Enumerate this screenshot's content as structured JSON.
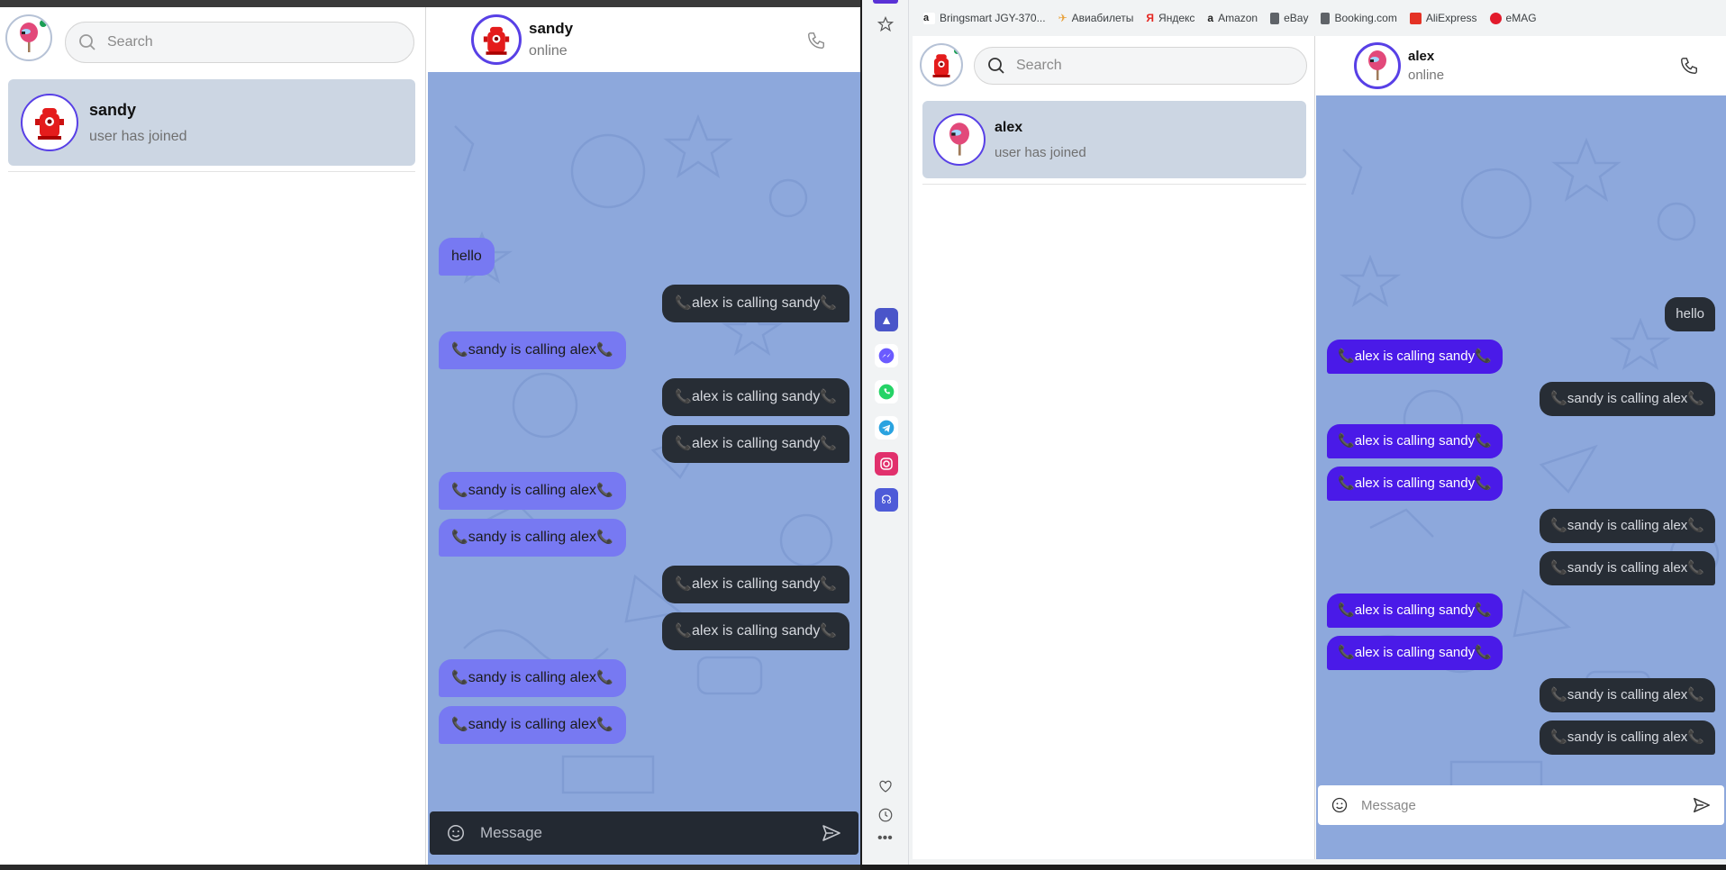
{
  "left_app": {
    "search_placeholder": "Search",
    "contact": {
      "name": "sandy",
      "subtitle": "user has joined"
    },
    "chat": {
      "name": "sandy",
      "status": "online",
      "composer_placeholder": "Message",
      "messages": [
        {
          "dir": "in",
          "text": "hello"
        },
        {
          "dir": "out",
          "text": "alex is calling sandy"
        },
        {
          "dir": "in",
          "text": "sandy is calling alex"
        },
        {
          "dir": "out",
          "text": "alex is calling sandy"
        },
        {
          "dir": "out",
          "text": "alex is calling sandy"
        },
        {
          "dir": "in",
          "text": "sandy is calling alex"
        },
        {
          "dir": "in",
          "text": "sandy is calling alex"
        },
        {
          "dir": "out",
          "text": "alex is calling sandy"
        },
        {
          "dir": "out",
          "text": "alex is calling sandy"
        },
        {
          "dir": "in",
          "text": "sandy is calling alex"
        },
        {
          "dir": "in",
          "text": "sandy is calling alex"
        }
      ]
    }
  },
  "right_app": {
    "bookmarks": [
      {
        "label": "Bringsmart JGY-370...",
        "icon": "amazon-icon",
        "color": "#222222"
      },
      {
        "label": "Авиабилеты",
        "icon": "plane-icon",
        "color": "#e8a13a"
      },
      {
        "label": "Яндекс",
        "icon": "yandex-icon",
        "color": "#e52620"
      },
      {
        "label": "Amazon",
        "icon": "amazon-icon",
        "color": "#222222"
      },
      {
        "label": "eBay",
        "icon": "page-icon",
        "color": "#5f6368"
      },
      {
        "label": "Booking.com",
        "icon": "page-icon",
        "color": "#5f6368"
      },
      {
        "label": "AliExpress",
        "icon": "aliexpress-icon",
        "color": "#e43225"
      },
      {
        "label": "eMAG",
        "icon": "emag-icon",
        "color": "#e21b2c"
      }
    ],
    "search_placeholder": "Search",
    "contact": {
      "name": "alex",
      "subtitle": "user has joined"
    },
    "chat": {
      "name": "alex",
      "status": "online",
      "composer_placeholder": "Message",
      "messages": [
        {
          "dir": "out",
          "text": "hello"
        },
        {
          "dir": "in",
          "text": "alex is calling sandy"
        },
        {
          "dir": "out",
          "text": "sandy is calling alex"
        },
        {
          "dir": "in",
          "text": "alex is calling sandy"
        },
        {
          "dir": "in",
          "text": "alex is calling sandy"
        },
        {
          "dir": "out",
          "text": "sandy is calling alex"
        },
        {
          "dir": "out",
          "text": "sandy is calling alex"
        },
        {
          "dir": "in",
          "text": "alex is calling sandy"
        },
        {
          "dir": "in",
          "text": "alex is calling sandy"
        },
        {
          "dir": "out",
          "text": "sandy is calling alex"
        },
        {
          "dir": "out",
          "text": "sandy is calling alex"
        }
      ]
    }
  },
  "colors": {
    "chat_background": "#8da8dc",
    "left_incoming_bubble": "#7779f2",
    "right_incoming_bubble": "#4a1ae8",
    "outgoing_bubble": "#272d35"
  },
  "icons": {
    "sidebar_strip": [
      "star-icon",
      "arc-app-icon",
      "messenger-icon",
      "whatsapp-icon",
      "telegram-icon",
      "instagram-icon",
      "headset-icon",
      "heart-icon",
      "history-icon",
      "more-icon"
    ]
  }
}
